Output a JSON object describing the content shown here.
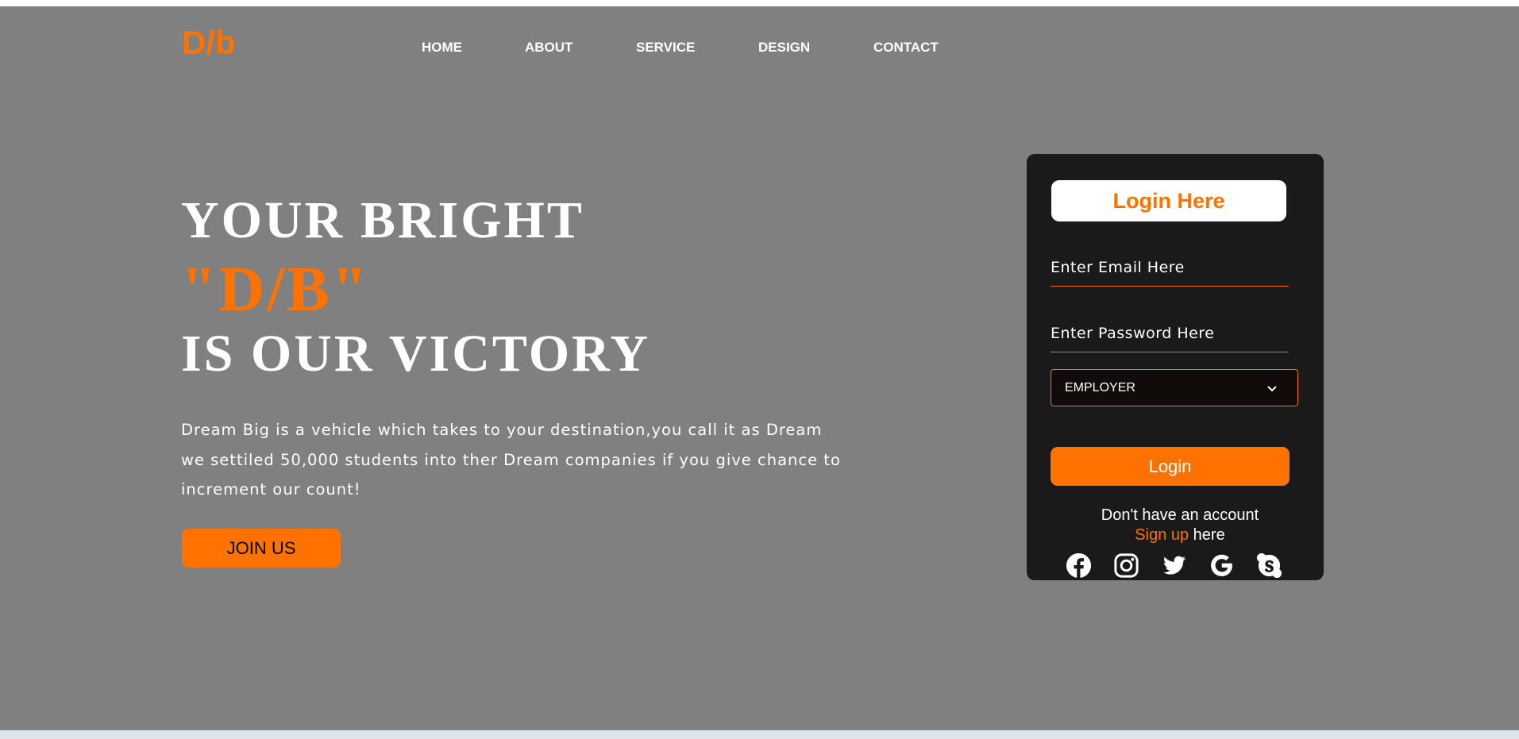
{
  "brand": {
    "logo": "D/b"
  },
  "nav": {
    "items": [
      "HOME",
      "ABOUT",
      "SERVICE",
      "DESIGN",
      "CONTACT"
    ]
  },
  "hero": {
    "line1": "YOUR BRIGHT",
    "line2": "\"D/B\"",
    "line3": "IS OUR VICTORY",
    "description": [
      "Dream Big is a vehicle which takes to your destination,you call it as Dream",
      "we settiled 50,000 students into ther Dream companies if you give chance to",
      "increment our count!"
    ],
    "join_label": "JOIN US"
  },
  "login": {
    "title": "Login Here",
    "email_placeholder": "Enter Email Here",
    "password_placeholder": "Enter Password Here",
    "role_selected": "EMPLOYER",
    "login_label": "Login",
    "no_account": "Don't have an account",
    "signup_link": "Sign up",
    "signup_suffix": " here",
    "socials": [
      "facebook-icon",
      "instagram-icon",
      "twitter-icon",
      "google-icon",
      "skype-icon"
    ]
  },
  "colors": {
    "accent": "#ff7200",
    "page_bg": "#808080",
    "card_bg": "#1b1a1a"
  }
}
